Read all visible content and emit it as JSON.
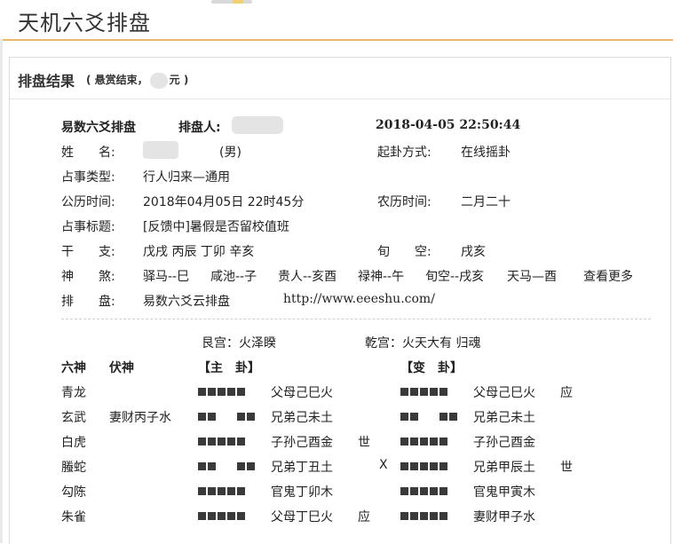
{
  "header": {
    "title": "天机六爻排盘"
  },
  "panel": {
    "title": "排盘结果",
    "note_prefix": "( 悬赏结束，",
    "note_suffix": "元 )"
  },
  "info": {
    "method_label": "易数六爻排盘",
    "caster_label": "排盘人:",
    "datetime": "2018-04-05 22:50:44",
    "name_label": "姓　　名:",
    "gender": "(男)",
    "cast_method_label": "起卦方式:",
    "cast_method": "在线摇卦",
    "type_label": "占事类型:",
    "type_value": "行人归来—通用",
    "solar_label": "公历时间:",
    "solar_value": "2018年04月05日 22时45分",
    "lunar_label": "农历时间:",
    "lunar_value": "二月二十",
    "title_label": "占事标题:",
    "title_value": "[反馈中]暑假是否留校值班",
    "ganzhi_label": "干　　支:",
    "ganzhi_value": "戊戌  丙辰  丁卯  辛亥",
    "xun_label": "旬　　空:",
    "xun_value": "戌亥",
    "shensha_label": "神　　煞:",
    "shensha": [
      "驿马--巳",
      "咸池--子",
      "贵人--亥酉",
      "禄神--午",
      "旬空--戌亥",
      "天马—酉"
    ],
    "more_link": "查看更多",
    "pan_label": "排　　盘:",
    "pan_value": "易数六爻云排盘",
    "url": "http://www.eeeshu.com/"
  },
  "palaces": {
    "main": "艮宫：火泽睽",
    "changed": "乾宫：火天大有  归魂"
  },
  "table_headers": {
    "liushen": "六神",
    "fushen": "伏神",
    "main": "【主　卦】",
    "changed": "【变　卦】"
  },
  "rows": [
    {
      "liushen": "青龙",
      "fushen": "",
      "main_yang": true,
      "main_label": "父母己巳火",
      "shi_ying": "",
      "moving": "",
      "changed_yang": true,
      "changed_label": "父母己巳火",
      "changed_mark": "应"
    },
    {
      "liushen": "玄武",
      "fushen": "妻财丙子水",
      "main_yang": false,
      "main_label": "兄弟己未土",
      "shi_ying": "",
      "moving": "",
      "changed_yang": false,
      "changed_label": "兄弟己未土",
      "changed_mark": ""
    },
    {
      "liushen": "白虎",
      "fushen": "",
      "main_yang": true,
      "main_label": "子孙己酉金",
      "shi_ying": "世",
      "moving": "",
      "changed_yang": true,
      "changed_label": "子孙己酉金",
      "changed_mark": ""
    },
    {
      "liushen": "螣蛇",
      "fushen": "",
      "main_yang": false,
      "main_label": "兄弟丁丑土",
      "shi_ying": "",
      "moving": "X",
      "changed_yang": true,
      "changed_label": "兄弟甲辰土",
      "changed_mark": "世"
    },
    {
      "liushen": "勾陈",
      "fushen": "",
      "main_yang": true,
      "main_label": "官鬼丁卯木",
      "shi_ying": "",
      "moving": "",
      "changed_yang": true,
      "changed_label": "官鬼甲寅木",
      "changed_mark": ""
    },
    {
      "liushen": "朱雀",
      "fushen": "",
      "main_yang": true,
      "main_label": "父母丁巳火",
      "shi_ying": "应",
      "moving": "",
      "changed_yang": true,
      "changed_label": "妻财甲子水",
      "changed_mark": ""
    }
  ]
}
